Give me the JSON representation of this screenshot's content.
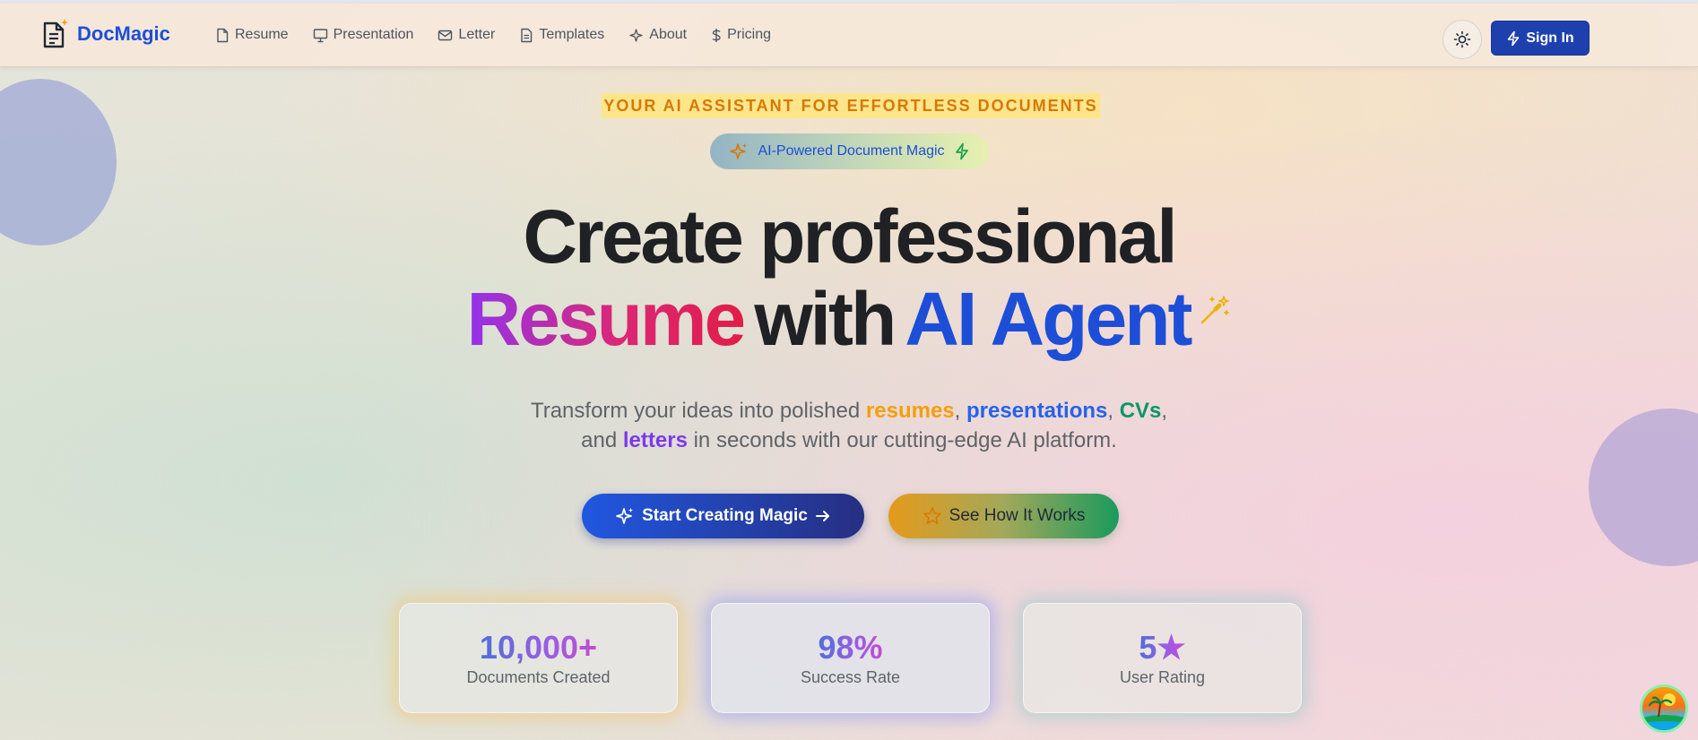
{
  "header": {
    "brand": "DocMagic",
    "nav": [
      {
        "label": "Resume",
        "icon": "file-icon"
      },
      {
        "label": "Presentation",
        "icon": "presentation-icon"
      },
      {
        "label": "Letter",
        "icon": "mail-icon"
      },
      {
        "label": "Templates",
        "icon": "file-text-icon"
      },
      {
        "label": "About",
        "icon": "sparkles-icon"
      },
      {
        "label": "Pricing",
        "icon": "dollar-icon"
      }
    ],
    "theme_toggle_icon": "sun-icon",
    "sign_in_label": "Sign In"
  },
  "hero": {
    "tagline": "YOUR AI ASSISTANT FOR EFFORTLESS DOCUMENTS",
    "pill_label": "AI-Powered Document Magic",
    "headline_line1": "Create professional",
    "headline_word": "Resume",
    "headline_with": "with",
    "headline_agent": "AI Agent",
    "subtitle": {
      "part1": "Transform your ideas into polished ",
      "kw1": "resumes",
      "sep1": ", ",
      "kw2": "presentations",
      "sep2": ", ",
      "kw3": "CVs",
      "sep3": ",",
      "part2": "and ",
      "kw4": "letters",
      "part3": " in seconds with our cutting-edge AI platform."
    },
    "primary_cta": "Start Creating Magic",
    "secondary_cta": "See How It Works"
  },
  "stats": [
    {
      "value": "10,000+",
      "label": "Documents Created"
    },
    {
      "value": "98%",
      "label": "Success Rate"
    },
    {
      "value": "5★",
      "label": "User Rating"
    }
  ],
  "colors": {
    "brand": "#1d4ed8",
    "resumes": "#f59e0b",
    "presentations": "#2563eb",
    "cvs": "#059669",
    "letters": "#7c3aed"
  }
}
